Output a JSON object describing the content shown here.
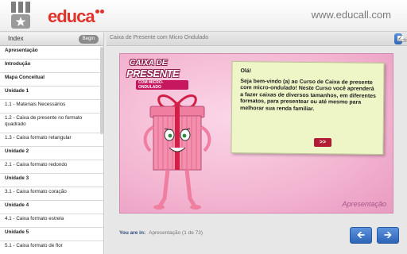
{
  "header": {
    "logo_text": "educa",
    "site_url": "www.educall.com"
  },
  "sidebar": {
    "title": "Index",
    "begin_label": "Begin",
    "items": [
      {
        "label": "Apresentação",
        "kind": "section"
      },
      {
        "label": "Introdução",
        "kind": "section"
      },
      {
        "label": "Mapa Conceitual",
        "kind": "section"
      },
      {
        "label": "Unidade 1",
        "kind": "section"
      },
      {
        "label": "1.1 - Materiais Necessários",
        "kind": "sub"
      },
      {
        "label": "1.2 - Caixa de presente no formato quadrado",
        "kind": "sub-tall"
      },
      {
        "label": "1.3 - Caixa formato retangular",
        "kind": "sub"
      },
      {
        "label": "Unidade 2",
        "kind": "section"
      },
      {
        "label": "2.1 - Caixa formato redondo",
        "kind": "sub"
      },
      {
        "label": "Unidade 3",
        "kind": "section"
      },
      {
        "label": "3.1 - Caixa formato coração",
        "kind": "sub"
      },
      {
        "label": "Unidade 4",
        "kind": "section"
      },
      {
        "label": "4.1 - Caixa formato estrela",
        "kind": "sub"
      },
      {
        "label": "Unidade 5",
        "kind": "section"
      },
      {
        "label": "5.1 - Caixa formato de flor",
        "kind": "sub"
      }
    ]
  },
  "content": {
    "title": "Caixa de Presente com Micro Ondulado",
    "activities_label": "Activities"
  },
  "slide": {
    "brand_line1": "CAIXA DE",
    "brand_line2": "PRESENTE",
    "brand_line3": "COM MICRO-ONDULADO",
    "greeting": "Olá!",
    "body": "Seja bem-vindo (a) ao Curso de Caixa de presente com micro-ondulado! Neste Curso você aprenderá a fazer caixas de diversos tamanhos, em diferentes formatos, para presentear ou até mesmo para melhorar sua renda familiar.",
    "next_inline_label": ">>",
    "caption": "Apresentação"
  },
  "footer": {
    "location_label": "You are in:",
    "location_value": "Apresentação (1 de 73)",
    "prev_icon": "arrow-left-icon",
    "next_icon": "arrow-right-icon"
  },
  "colors": {
    "brand_red": "#e1322b",
    "accent_blue": "#2f67b8",
    "slide_pink": "#f3b5d1",
    "note_green": "#eef6c8",
    "button_maroon": "#b11b36"
  }
}
